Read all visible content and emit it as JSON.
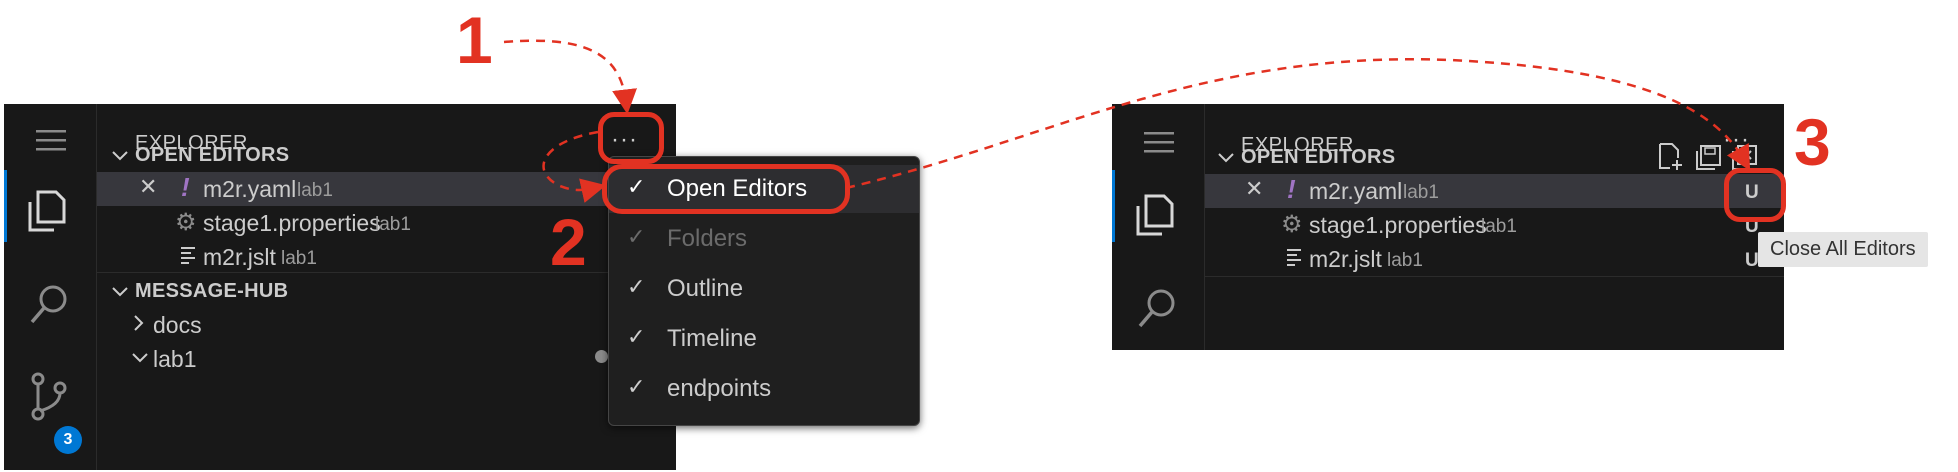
{
  "left_panel": {
    "title": "EXPLORER",
    "more_glyph": "···",
    "open_editors_section": "OPEN EDITORS",
    "editors": [
      {
        "name": "m2r.yaml",
        "desc": "lab1",
        "icon": "exclamation-icon",
        "close": "✕"
      },
      {
        "name": "stage1.properties",
        "desc": "lab1",
        "icon": "gear-icon"
      },
      {
        "name": "m2r.jslt",
        "desc": "lab1",
        "icon": "lines-icon"
      }
    ],
    "workspace_section": "MESSAGE-HUB",
    "tree": [
      {
        "name": "docs",
        "expanded": false
      },
      {
        "name": "lab1",
        "expanded": true
      }
    ],
    "scm_badge": "3"
  },
  "menu": {
    "items": [
      {
        "label": "Open Editors",
        "checked": true,
        "enabled": true,
        "highlighted": true
      },
      {
        "label": "Folders",
        "checked": true,
        "enabled": false
      },
      {
        "label": "Outline",
        "checked": true,
        "enabled": true
      },
      {
        "label": "Timeline",
        "checked": true,
        "enabled": true
      },
      {
        "label": "endpoints",
        "checked": true,
        "enabled": true
      }
    ],
    "check_glyph": "✓"
  },
  "right_panel": {
    "title": "EXPLORER",
    "more_glyph": "···",
    "open_editors_section": "OPEN EDITORS",
    "editors": [
      {
        "name": "m2r.yaml",
        "desc": "lab1",
        "status": "U",
        "close": "✕"
      },
      {
        "name": "stage1.properties",
        "desc": "lab1",
        "status": "U"
      },
      {
        "name": "m2r.jslt",
        "desc": "lab1",
        "status": "U"
      }
    ],
    "tooltip": "Close All Editors"
  },
  "steps": [
    "1",
    "2",
    "3"
  ],
  "colors": {
    "annotation": "#e23222",
    "panel_bg": "#181818",
    "badge": "#0078d4",
    "yaml_icon": "#a074c4",
    "active_bar": "#0078d4"
  }
}
